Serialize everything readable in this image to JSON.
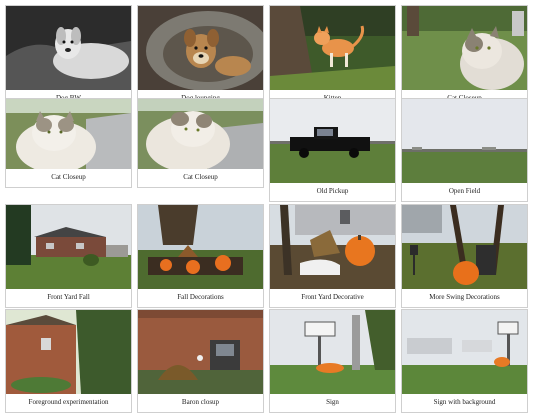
{
  "gallery": {
    "items": [
      {
        "caption": "Dog BW"
      },
      {
        "caption": "Dog lounging"
      },
      {
        "caption": "Kitten"
      },
      {
        "caption": "Cat Closeup"
      },
      {
        "caption": "Cat Closeup"
      },
      {
        "caption": "Cat Closeup"
      },
      {
        "caption": "Old Pickup"
      },
      {
        "caption": "Open Field"
      },
      {
        "caption": "Front Yard Fall"
      },
      {
        "caption": "Fall Decorations"
      },
      {
        "caption": "Front Yard Decorative"
      },
      {
        "caption": "More Swing Decorations"
      },
      {
        "caption": "Foreground experimentation"
      },
      {
        "caption": "Baron closup"
      },
      {
        "caption": "Sign"
      },
      {
        "caption": "Sign with background"
      }
    ]
  }
}
